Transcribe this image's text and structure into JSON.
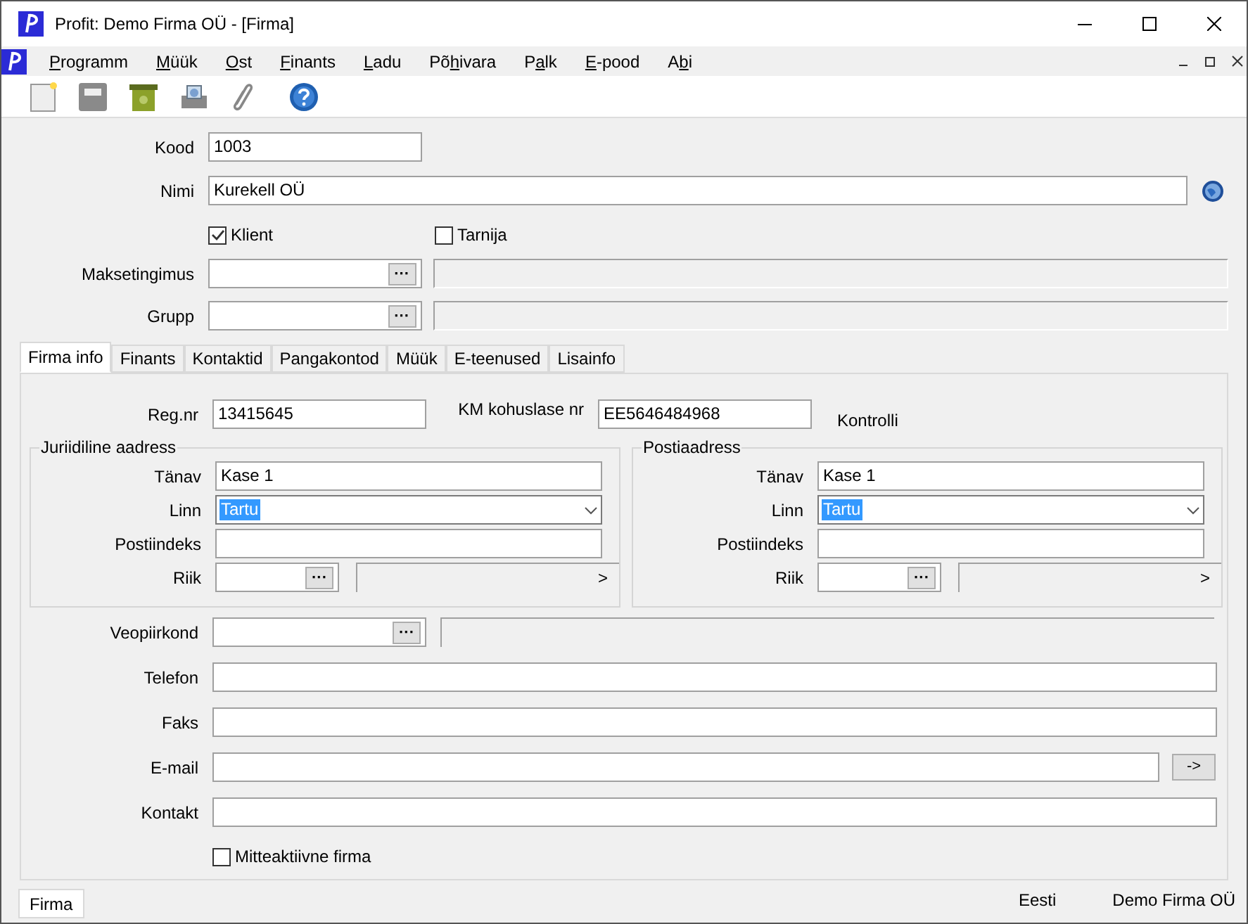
{
  "window": {
    "title": "Profit: Demo Firma OÜ - [Firma]"
  },
  "menu": [
    {
      "access_key": "P",
      "after": "rogramm"
    },
    {
      "access_key": "M",
      "after": "üük"
    },
    {
      "access_key": "O",
      "after": "st"
    },
    {
      "access_key": "F",
      "after": "inants"
    },
    {
      "access_key": "L",
      "after": "adu"
    },
    {
      "before": "Põ",
      "access_key": "h",
      "after": "ivara"
    },
    {
      "before": "P",
      "access_key": "a",
      "after": "lk"
    },
    {
      "access_key": "E",
      "after": "-pood"
    },
    {
      "before": "A",
      "access_key": "b",
      "after": "i"
    }
  ],
  "header": {
    "kood": {
      "label": "Kood",
      "value": "1003"
    },
    "nimi": {
      "label": "Nimi",
      "value": "Kurekell OÜ"
    },
    "checks": [
      {
        "label": "Klient",
        "checked": true
      },
      {
        "label": "Tarnija",
        "checked": false
      }
    ],
    "lookups": [
      {
        "label": "Maksetingimus",
        "button": "···"
      },
      {
        "label": "Grupp",
        "button": "···"
      }
    ]
  },
  "tabs": [
    {
      "label": "Firma info",
      "selected": true
    },
    {
      "label": "Finants",
      "selected": false
    },
    {
      "label": "Kontaktid",
      "selected": false
    },
    {
      "label": "Pangakontod",
      "selected": false
    },
    {
      "label": "Müük",
      "selected": false
    },
    {
      "label": "E-teenused",
      "selected": false
    },
    {
      "label": "Lisainfo",
      "selected": false
    }
  ],
  "firma_info": {
    "reg_nr": {
      "label": "Reg.nr",
      "value": "13415645"
    },
    "km": {
      "label": "KM kohuslase nr",
      "value": "EE5646484968"
    },
    "check_link": "Kontrolli",
    "addresses": [
      {
        "title": "Juriidiline aadress",
        "street_label": "Tänav",
        "street": "Kase 1",
        "city_label": "Linn",
        "city": "Tartu",
        "zip_label": "Postiindeks",
        "country_label": "Riik",
        "country_button": "···",
        "country_arrow": ">"
      },
      {
        "title": "Postiaadress",
        "street_label": "Tänav",
        "street": "Kase 1",
        "city_label": "Linn",
        "city": "Tartu",
        "zip_label": "Postiindeks",
        "country_label": "Riik",
        "country_button": "···",
        "country_arrow": ">"
      }
    ],
    "veopiirkond": {
      "label": "Veopiirkond",
      "button": "···"
    },
    "fields": [
      {
        "label": "Telefon",
        "kind": "text"
      },
      {
        "label": "Faks",
        "kind": "text"
      },
      {
        "label": "E-mail",
        "kind": "email",
        "button": "->"
      },
      {
        "label": "Kontakt",
        "kind": "text"
      }
    ],
    "inactive": {
      "label": "Mitteaktiivne firma",
      "checked": false
    }
  },
  "status_bar": {
    "tab": "Firma",
    "language": "Eesti",
    "company": "Demo Firma OÜ"
  }
}
